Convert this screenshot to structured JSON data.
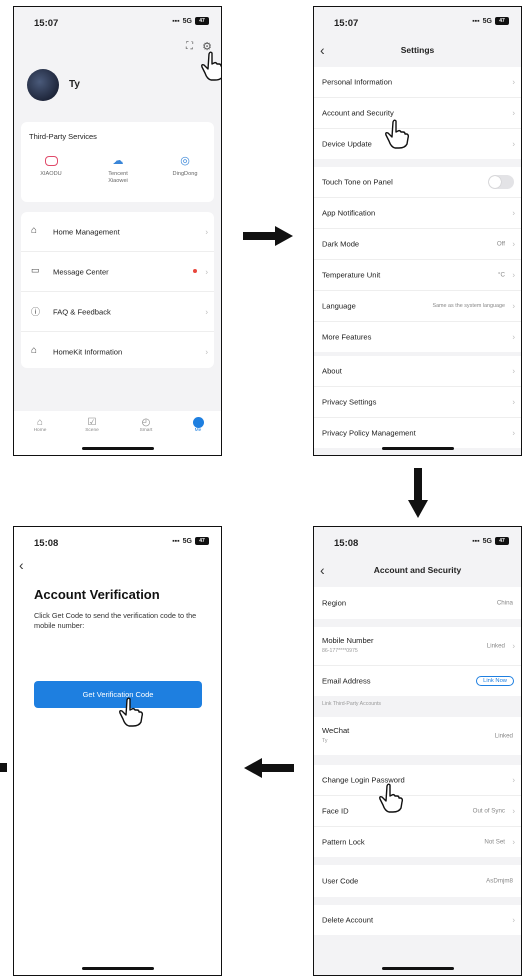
{
  "phone1": {
    "status": {
      "time": "15:07",
      "network": "5G",
      "battery": "47"
    },
    "user": {
      "name": "Ty"
    },
    "third_party": {
      "title": "Third-Party Services",
      "items": [
        {
          "label": "XIAODU",
          "icon": "xiaodu-icon",
          "color": "#e04a6a"
        },
        {
          "label": "Tencent Xiaowei",
          "icon": "cloud-icon",
          "color": "#3a86d8"
        },
        {
          "label": "DingDong",
          "icon": "dingdong-icon",
          "color": "#3a86d8"
        }
      ]
    },
    "menu": [
      {
        "label": "Home Management",
        "icon": "house-icon"
      },
      {
        "label": "Message Center",
        "icon": "message-icon",
        "dot": true
      },
      {
        "label": "FAQ & Feedback",
        "icon": "question-icon"
      },
      {
        "label": "HomeKit Information",
        "icon": "homekit-icon"
      }
    ],
    "tabs": [
      {
        "label": "Home",
        "icon": "home-tab-icon"
      },
      {
        "label": "Scene",
        "icon": "scene-tab-icon"
      },
      {
        "label": "Smart",
        "icon": "smart-tab-icon"
      },
      {
        "label": "Me",
        "icon": "me-tab-icon",
        "active": true
      }
    ]
  },
  "phone2": {
    "status": {
      "time": "15:07",
      "network": "5G",
      "battery": "47"
    },
    "title": "Settings",
    "groups": [
      [
        {
          "label": "Personal Information"
        },
        {
          "label": "Account and Security"
        },
        {
          "label": "Device Update"
        }
      ],
      [
        {
          "label": "Touch Tone on Panel",
          "toggle": true
        },
        {
          "label": "App Notification"
        },
        {
          "label": "Dark Mode",
          "value": "Off"
        },
        {
          "label": "Temperature Unit",
          "value": "°C"
        },
        {
          "label": "Language",
          "value": "Same as the system language"
        },
        {
          "label": "More Features"
        }
      ],
      [
        {
          "label": "About"
        },
        {
          "label": "Privacy Settings"
        },
        {
          "label": "Privacy Policy Management"
        }
      ]
    ]
  },
  "phone3": {
    "status": {
      "time": "15:08",
      "network": "5G",
      "battery": "47"
    },
    "title": "Account and Security",
    "region": {
      "label": "Region",
      "value": "China"
    },
    "mobile": {
      "label": "Mobile Number",
      "sub": "86-177****0975",
      "value": "Linked"
    },
    "email": {
      "label": "Email Address",
      "value": "Link Now"
    },
    "link_header": "Link Third-Party Accounts",
    "wechat": {
      "label": "WeChat",
      "sub": "Ty",
      "value": "Linked"
    },
    "security": [
      {
        "label": "Change Login Password",
        "value": ""
      },
      {
        "label": "Face ID",
        "value": "Out of Sync"
      },
      {
        "label": "Pattern Lock",
        "value": "Not Set"
      }
    ],
    "user_code": {
      "label": "User Code",
      "value": "AsDmjm8"
    },
    "delete": {
      "label": "Delete Account"
    }
  },
  "phone4": {
    "status": {
      "time": "15:08",
      "network": "5G",
      "battery": "47"
    },
    "heading": "Account Verification",
    "desc": "Click Get Code to send the verification code to the mobile number:",
    "button": "Get Verification Code",
    "accent": "#1e7fe0"
  }
}
